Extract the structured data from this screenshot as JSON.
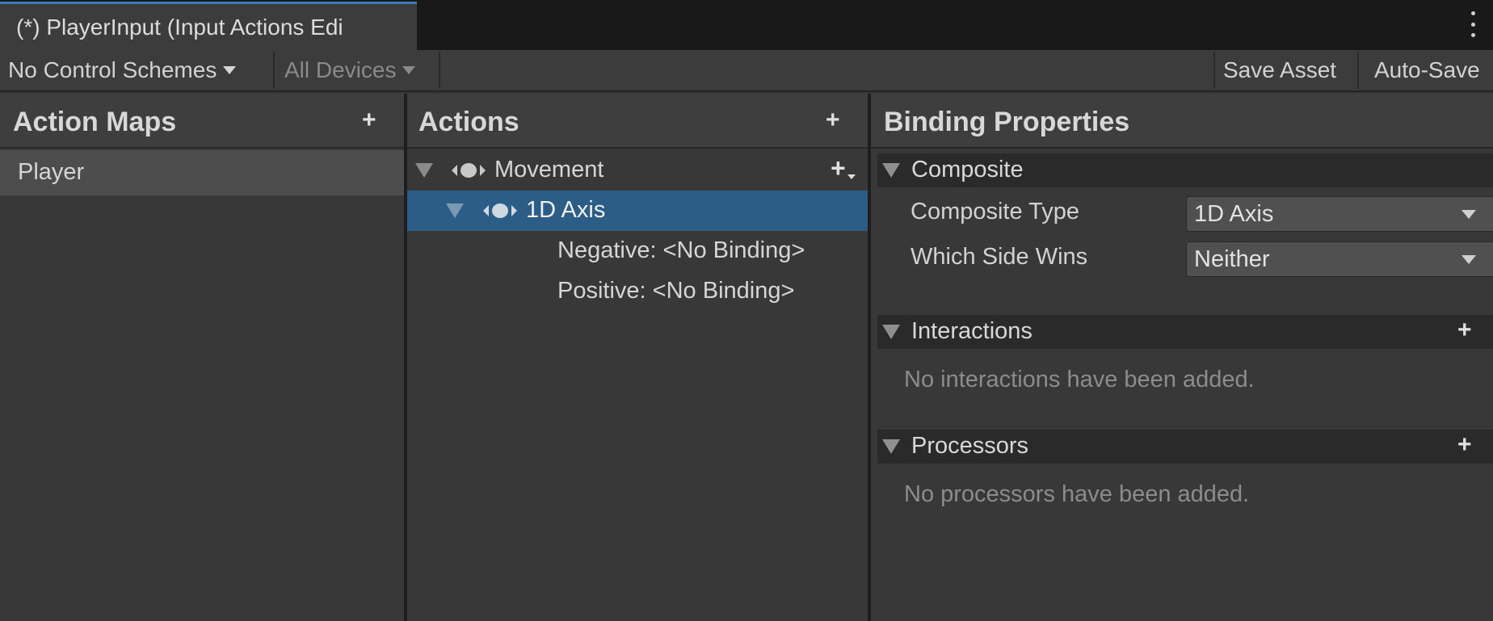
{
  "window": {
    "tab_title": "(*) PlayerInput (Input Actions Edi"
  },
  "toolbar": {
    "control_schemes": "No Control Schemes",
    "devices": "All Devices",
    "save_asset": "Save Asset",
    "auto_save": "Auto-Save"
  },
  "action_maps": {
    "title": "Action Maps",
    "add_glyph": "+",
    "items": [
      {
        "label": "Player",
        "selected": true
      }
    ]
  },
  "actions": {
    "title": "Actions",
    "add_glyph": "+",
    "add_binding_glyph": "+",
    "action": "Movement",
    "composite": "1D Axis",
    "bindings": [
      "Negative: <No Binding>",
      "Positive: <No Binding>"
    ]
  },
  "binding_properties": {
    "title": "Binding Properties",
    "composite": {
      "title": "Composite",
      "fields": [
        {
          "label": "Composite Type",
          "value": "1D Axis"
        },
        {
          "label": "Which Side Wins",
          "value": "Neither"
        }
      ]
    },
    "interactions": {
      "title": "Interactions",
      "add_glyph": "+",
      "empty": "No interactions have been added."
    },
    "processors": {
      "title": "Processors",
      "add_glyph": "+",
      "empty": "No processors have been added."
    }
  },
  "colors": {
    "selection": "#2c5d87",
    "accent": "#3a79bb",
    "background": "#383838"
  }
}
